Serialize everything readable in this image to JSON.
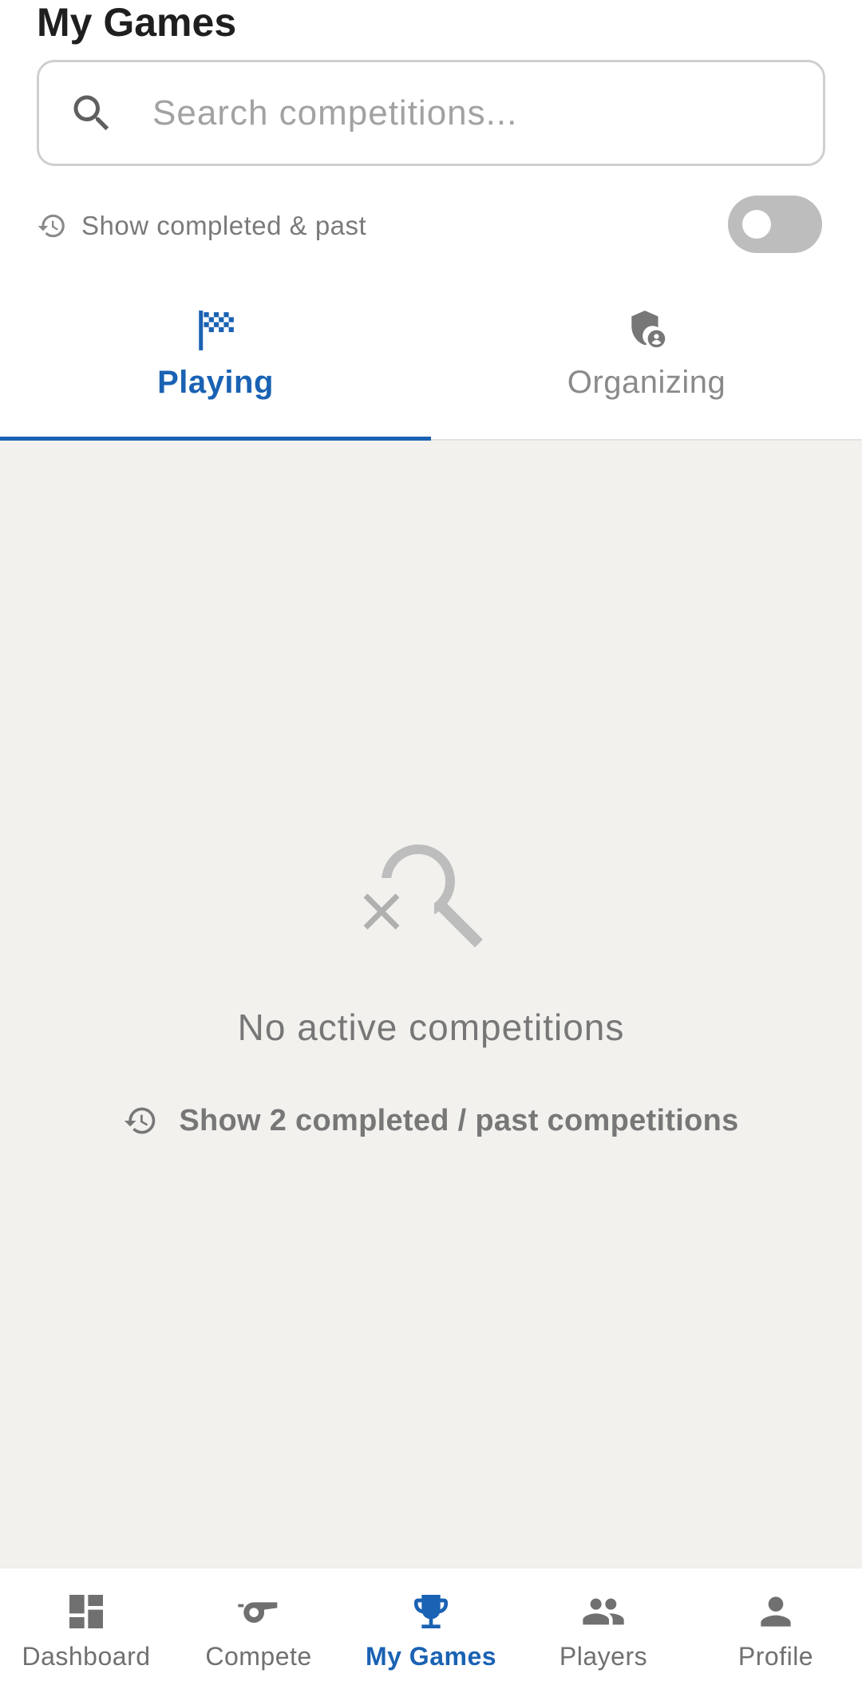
{
  "header": {
    "title": "My Games"
  },
  "search": {
    "placeholder": "Search competitions...",
    "value": ""
  },
  "filter": {
    "label": "Show completed & past",
    "enabled": false
  },
  "tabs": [
    {
      "label": "Playing",
      "icon": "checkered-flag-icon",
      "active": true
    },
    {
      "label": "Organizing",
      "icon": "shield-person-icon",
      "active": false
    }
  ],
  "empty_state": {
    "icon": "search-off-icon",
    "title": "No active competitions",
    "action_label": "Show 2 completed / past competitions"
  },
  "bottom_nav": [
    {
      "label": "Dashboard",
      "icon": "dashboard-icon",
      "active": false
    },
    {
      "label": "Compete",
      "icon": "whistle-icon",
      "active": false
    },
    {
      "label": "My Games",
      "icon": "trophy-icon",
      "active": true
    },
    {
      "label": "Players",
      "icon": "people-icon",
      "active": false
    },
    {
      "label": "Profile",
      "icon": "person-icon",
      "active": false
    }
  ],
  "colors": {
    "accent": "#1a62b3",
    "content_background": "#f2f1ee",
    "toggle_off": "#bdbdbd",
    "muted_text": "#777777"
  }
}
